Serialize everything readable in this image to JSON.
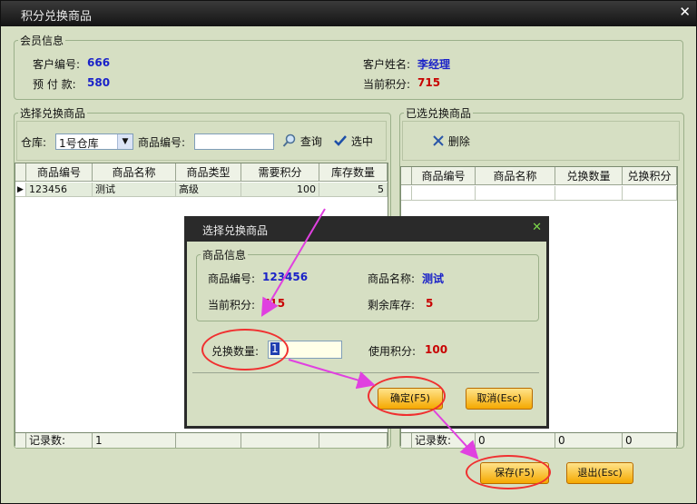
{
  "window": {
    "title": "积分兑换商品",
    "close": "✕"
  },
  "member": {
    "group_label": "会员信息",
    "customer_no_label": "客户编号:",
    "customer_no": "666",
    "customer_name_label": "客户姓名:",
    "customer_name": "李经理",
    "prepaid_label": "预 付 款:",
    "prepaid": "580",
    "points_label": "当前积分:",
    "points": "715"
  },
  "select_panel": {
    "group_label": "选择兑换商品",
    "warehouse_label": "仓库:",
    "warehouse_value": "1号仓库",
    "product_no_label": "商品编号:",
    "product_no_value": "",
    "query_label": "查询",
    "choose_label": "选中",
    "columns": [
      "商品编号",
      "商品名称",
      "商品类型",
      "需要积分",
      "库存数量"
    ],
    "rows": [
      {
        "no": "123456",
        "name": "测试",
        "type": "高级",
        "points": "100",
        "stock": "5"
      }
    ],
    "footer_label": "记录数:",
    "footer_count": "1"
  },
  "selected_panel": {
    "group_label": "已选兑换商品",
    "delete_label": "删除",
    "columns": [
      "商品编号",
      "商品名称",
      "兑换数量",
      "兑换积分"
    ],
    "footer_label": "记录数:",
    "footer_values": [
      "0",
      "0",
      "0"
    ]
  },
  "buttons": {
    "save": "保存(F5)",
    "exit": "退出(Esc)"
  },
  "dialog": {
    "title": "选择兑换商品",
    "close": "✕",
    "group_label": "商品信息",
    "product_no_label": "商品编号:",
    "product_no": "123456",
    "product_name_label": "商品名称:",
    "product_name": "测试",
    "points_label": "当前积分:",
    "points": "715",
    "stock_label": "剩余库存:",
    "stock": "5",
    "qty_label": "兑换数量:",
    "qty_value": "1",
    "use_points_label": "使用积分:",
    "use_points": "100",
    "ok": "确定(F5)",
    "cancel": "取消(Esc)"
  },
  "colors": {
    "annotation": "#e040e0",
    "highlight": "#f03030"
  }
}
